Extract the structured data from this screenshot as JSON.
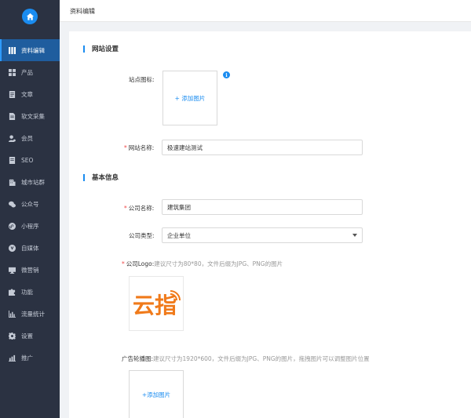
{
  "header": {
    "title": "资料编辑"
  },
  "sidebar": {
    "items": [
      {
        "label": "资料编辑",
        "icon": "columns-icon",
        "active": true
      },
      {
        "label": "产品",
        "icon": "grid-icon"
      },
      {
        "label": "文章",
        "icon": "document-icon"
      },
      {
        "label": "软文采集",
        "icon": "file-collect-icon"
      },
      {
        "label": "会员",
        "icon": "user-icon"
      },
      {
        "label": "SEO",
        "icon": "seo-icon"
      },
      {
        "label": "城市站群",
        "icon": "building-icon"
      },
      {
        "label": "公众号",
        "icon": "wechat-icon"
      },
      {
        "label": "小程序",
        "icon": "mini-program-icon"
      },
      {
        "label": "自媒体",
        "icon": "media-icon"
      },
      {
        "label": "微营销",
        "icon": "marketing-icon"
      },
      {
        "label": "功能",
        "icon": "puzzle-icon"
      },
      {
        "label": "流量统计",
        "icon": "bar-chart-icon"
      },
      {
        "label": "设置",
        "icon": "gear-icon"
      },
      {
        "label": "推广",
        "icon": "promote-icon"
      }
    ]
  },
  "website": {
    "section_title": "网站设置",
    "icon_label": "站点图标:",
    "icon_upload": "+ 添加图片",
    "name_label": "网站名称:",
    "name_value": "极速建站测试",
    "info": "i"
  },
  "basic": {
    "section_title": "基本信息",
    "company_name_label": "公司名称:",
    "company_name_value": "建筑集团",
    "company_type_label": "公司类型:",
    "company_type_value": "企业单位",
    "logo_label": "公司Logo:",
    "logo_hint": "建议尺寸为80*80，文件后缀为JPG、PNG的图片",
    "logo_text": "云指",
    "banner_label": "广告轮播图:",
    "banner_hint": "建议尺寸为1920*600，文件后缀为JPG、PNG的图片，拖拽图片可以调整图片位置",
    "banner_upload": "+添加图片"
  },
  "colors": {
    "sidebar_bg": "#2b3242",
    "active_bg": "#1f5d9e",
    "accent": "#1a8cf0",
    "logo_orange": "#f07a1a",
    "required": "#f04848"
  }
}
